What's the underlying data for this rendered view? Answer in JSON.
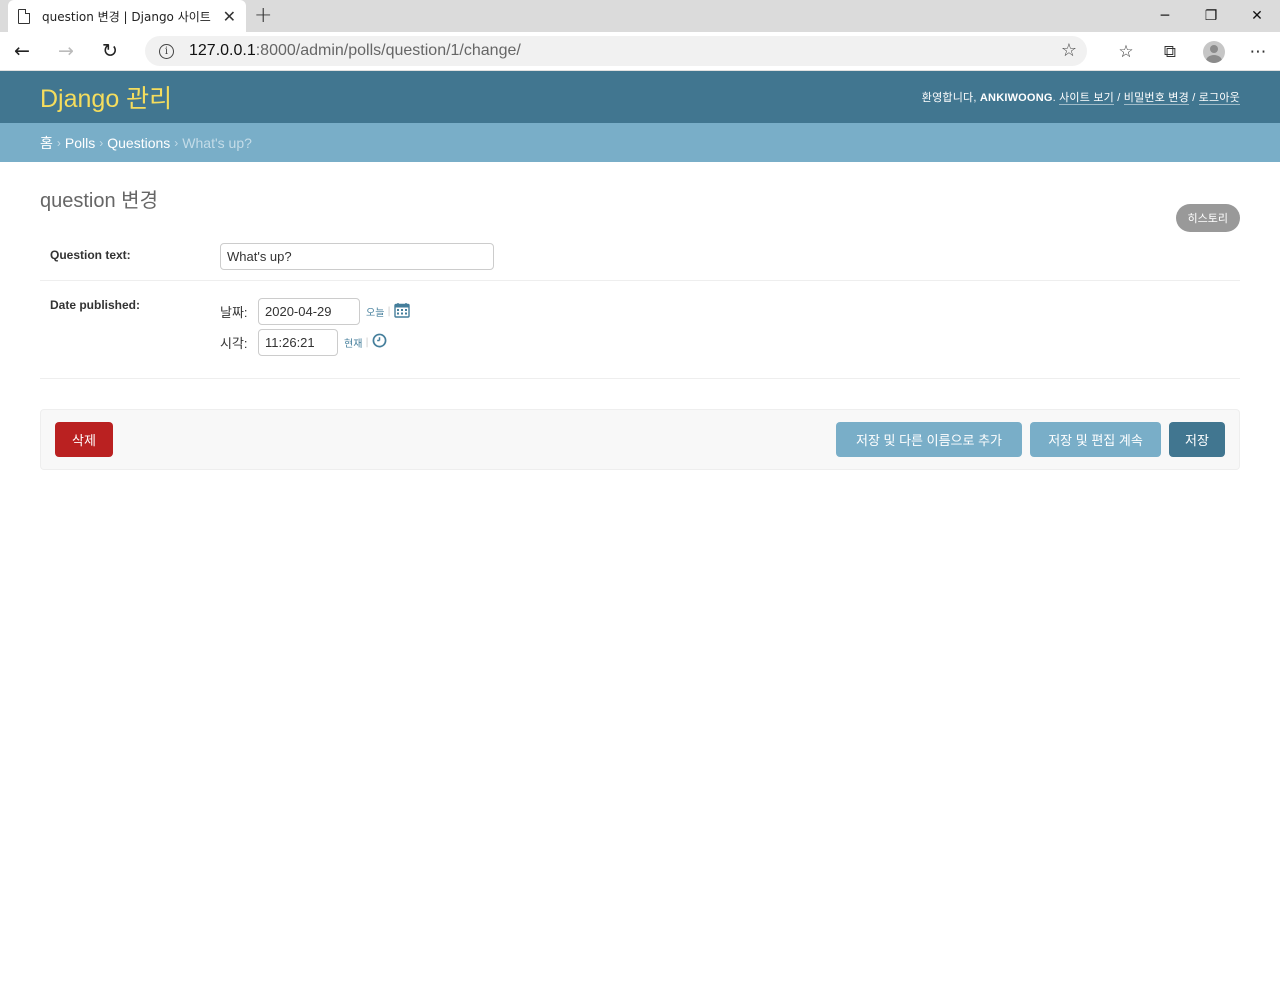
{
  "browser": {
    "tab_title": "question 변경 | Django 사이트 관",
    "url_host": "127.0.0.1",
    "url_rest": ":8000/admin/polls/question/1/change/"
  },
  "header": {
    "branding": "Django 관리",
    "welcome": "환영합니다,",
    "username": "ANKIWOONG",
    "view_site": "사이트 보기",
    "change_password": "비밀번호 변경",
    "logout": "로그아웃"
  },
  "breadcrumbs": {
    "home": "홈",
    "app": "Polls",
    "model": "Questions",
    "current": "What's up?"
  },
  "page": {
    "title": "question 변경",
    "history": "히스토리"
  },
  "form": {
    "question_text_label": "Question text:",
    "question_text_value": "What's up?",
    "date_published_label": "Date published:",
    "date_label": "날짜:",
    "date_value": "2020-04-29",
    "today_link": "오늘",
    "time_label": "시각:",
    "time_value": "11:26:21",
    "now_link": "현재"
  },
  "actions": {
    "delete": "삭제",
    "save_add_another": "저장 및 다른 이름으로 추가",
    "save_continue": "저장 및 편집 계속",
    "save": "저장"
  },
  "colors": {
    "header_bg": "#417690",
    "branding": "#f5dd5d",
    "breadcrumbs_bg": "#79aec8",
    "delete": "#ba2121"
  }
}
